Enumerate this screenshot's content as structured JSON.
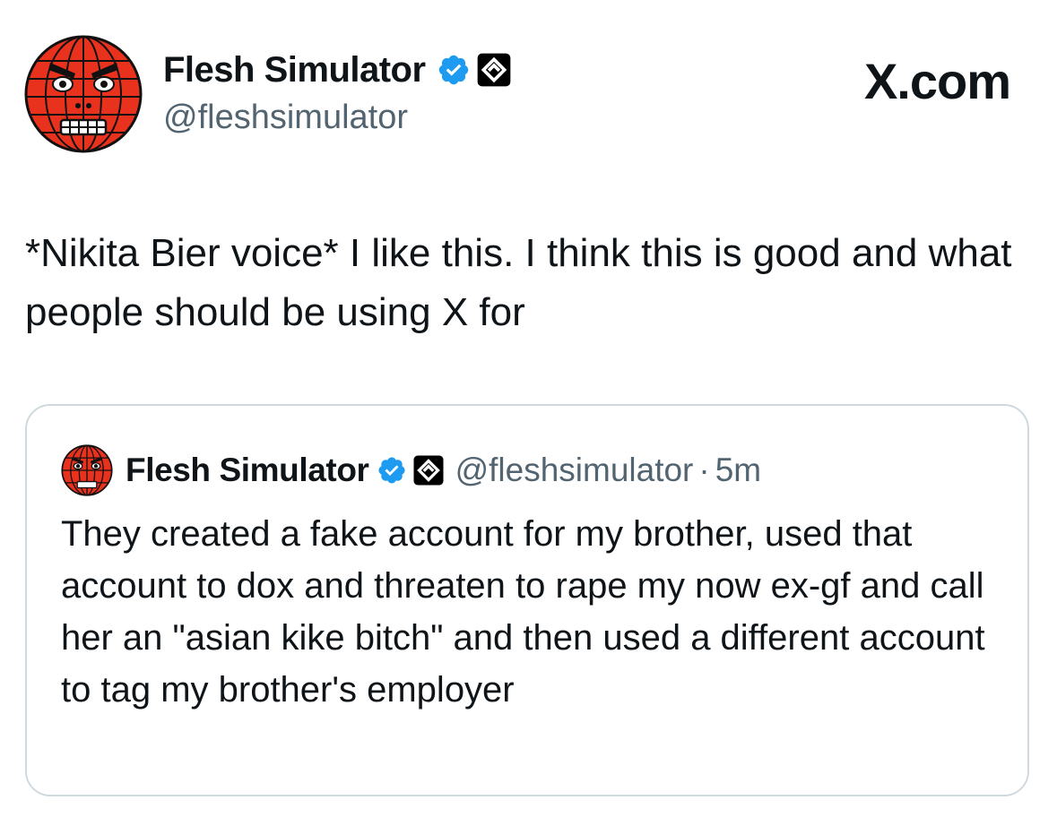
{
  "author": {
    "display_name": "Flesh Simulator",
    "handle": "@fleshsimulator",
    "avatar_icon": "red-wireframe-globe-face-avatar",
    "verified_icon": "verified-badge-icon",
    "affiliation_icon": "affiliation-badge-icon"
  },
  "brand": {
    "label": "X.com"
  },
  "tweet": {
    "text": "*Nikita Bier voice* I like this. I think this is good and what people should be using X for"
  },
  "quoted_tweet": {
    "display_name": "Flesh Simulator",
    "handle": "@fleshsimulator",
    "separator": "·",
    "timestamp": "5m",
    "text": "They created a fake account for my brother, used that account to dox and threaten to rape my now ex-gf and call her an \"asian kike bitch\" and then used a different account to tag my brother's employer"
  },
  "colors": {
    "verified_blue": "#1d9bf0",
    "avatar_red": "#e8321e",
    "secondary_text": "#536471",
    "border": "#cfd9de"
  }
}
